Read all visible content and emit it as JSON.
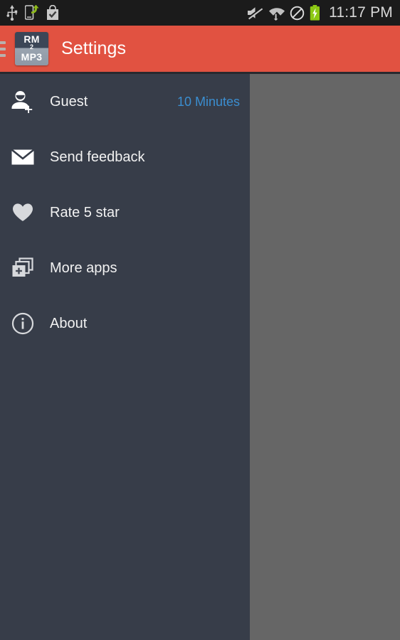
{
  "status_bar": {
    "background_color": "#1b1b1b",
    "clock": "11:17 PM",
    "left_icons": [
      {
        "name": "usb-icon",
        "label": "USB connected"
      },
      {
        "name": "usb-debugging-icon",
        "label": "USB debugging / file transfer"
      },
      {
        "name": "play-store-download-icon",
        "label": "Play Store download complete"
      }
    ],
    "right_icons": [
      {
        "name": "mute-icon",
        "label": "Sound muted"
      },
      {
        "name": "wifi-icon",
        "label": "Wi-Fi connected with activity"
      },
      {
        "name": "do-not-disturb-icon",
        "label": "Do not disturb"
      },
      {
        "name": "battery-charging-icon",
        "label": "Battery charging"
      }
    ]
  },
  "app_bar": {
    "background_color": "#e15241",
    "title": "Settings",
    "menu_icon_name": "hamburger-menu-icon",
    "app_icon": {
      "line1": "RM",
      "line2": "2",
      "line3": "MP3"
    }
  },
  "drawer": {
    "background_color": "#373d49",
    "accent_color": "#3b8ed0",
    "items": [
      {
        "icon": "person-add-icon",
        "label": "Guest",
        "value": "10 Minutes"
      },
      {
        "icon": "email-icon",
        "label": "Send feedback",
        "value": ""
      },
      {
        "icon": "heart-icon",
        "label": "Rate 5 star",
        "value": ""
      },
      {
        "icon": "more-apps-icon",
        "label": "More apps",
        "value": ""
      },
      {
        "icon": "info-icon",
        "label": "About",
        "value": ""
      }
    ]
  },
  "scrim": {
    "color": "#666666"
  }
}
